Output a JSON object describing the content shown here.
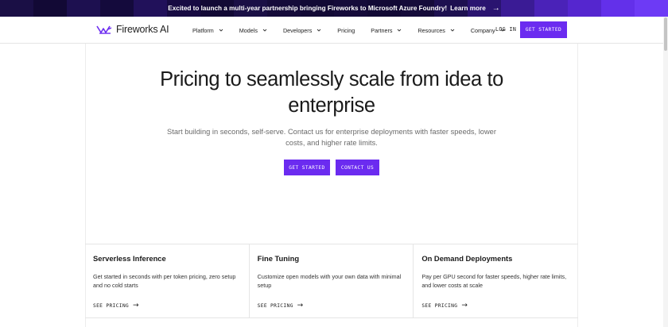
{
  "banner": {
    "text": "Excited to launch a multi-year partnership bringing Fireworks to Microsoft Azure Foundry!",
    "link": "Learn more",
    "arrow_icon": "arrow-right-icon",
    "bg_color": "#150b3a"
  },
  "nav": {
    "brand": "Fireworks AI",
    "logo_icon": "fireworks-logo-icon",
    "items": [
      {
        "label": "Platform",
        "dropdown": true
      },
      {
        "label": "Models",
        "dropdown": true
      },
      {
        "label": "Developers",
        "dropdown": true
      },
      {
        "label": "Pricing",
        "dropdown": false
      },
      {
        "label": "Partners",
        "dropdown": true
      },
      {
        "label": "Resources",
        "dropdown": true
      },
      {
        "label": "Company",
        "dropdown": true
      }
    ],
    "login": "LOG IN",
    "cta": "GET STARTED"
  },
  "hero": {
    "title": "Pricing to seamlessly scale from idea to enterprise",
    "subtitle": "Start building in seconds, self-serve. Contact us for enterprise deployments with faster speeds, lower costs, and higher rate limits.",
    "primary_button": "GET STARTED",
    "secondary_button": "CONTACT US"
  },
  "cards": [
    {
      "title": "Serverless Inference",
      "description": "Get started in seconds with per token pricing, zero setup and no cold starts",
      "link": "SEE PRICING"
    },
    {
      "title": "Fine Tuning",
      "description": "Customize open models with your own data with minimal setup",
      "link": "SEE PRICING"
    },
    {
      "title": "On Demand Deployments",
      "description": "Pay per GPU second for faster speeds, higher rate limits, and lower costs at scale",
      "link": "SEE PRICING"
    }
  ],
  "colors": {
    "accent": "#6b2bf0",
    "text": "#1a1a1a",
    "muted": "#6a6a6a"
  }
}
